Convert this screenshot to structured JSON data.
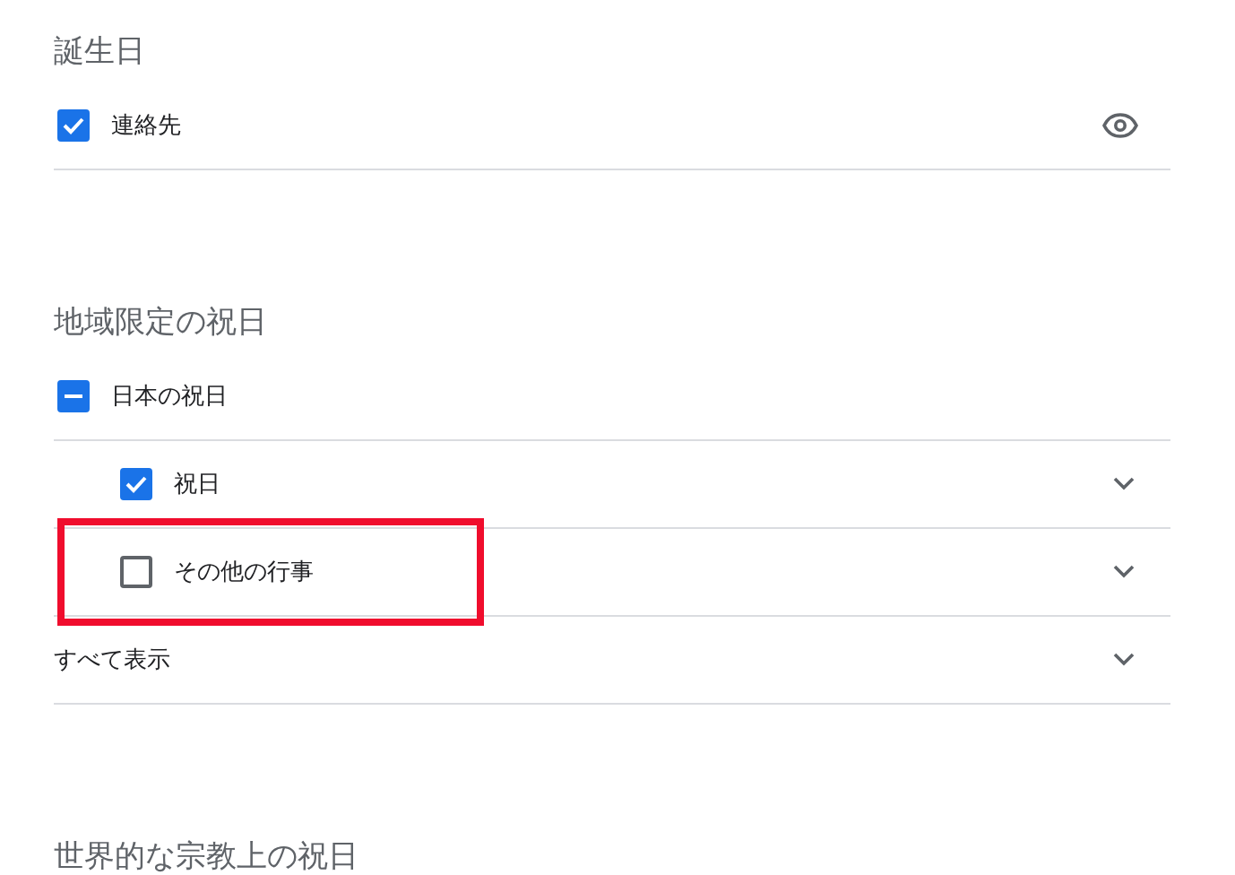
{
  "sections": [
    {
      "title": "誕生日",
      "rows": [
        {
          "kind": "visible",
          "label": "連絡先",
          "checked": true
        }
      ]
    },
    {
      "title": "地域限定の祝日",
      "rows": [
        {
          "kind": "group",
          "label": "日本の祝日",
          "checked": false,
          "indeterminate": true
        },
        {
          "kind": "child",
          "label": "祝日",
          "checked": true
        },
        {
          "kind": "child",
          "label": "その他の行事",
          "checked": false,
          "highlighted": true
        }
      ],
      "show_all": {
        "label": "すべて表示"
      }
    },
    {
      "title": "世界的な宗教上の祝日"
    }
  ]
}
